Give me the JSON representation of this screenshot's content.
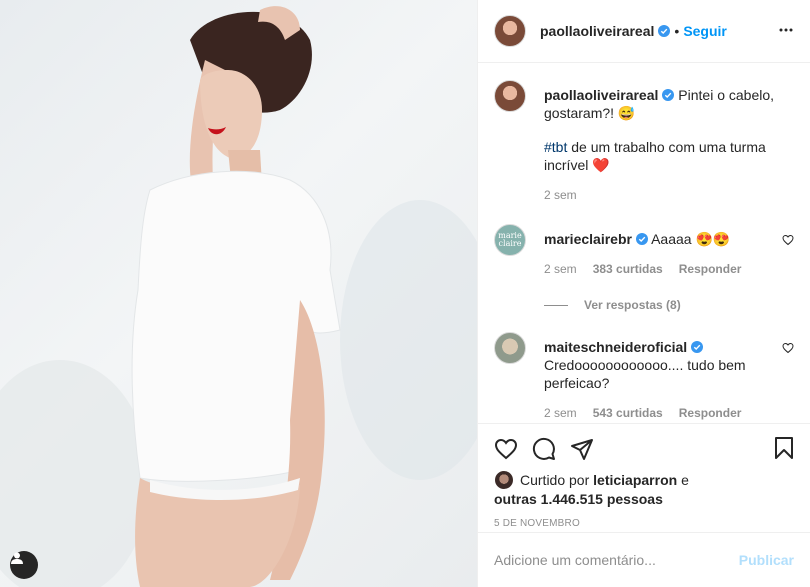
{
  "post": {
    "username": "paollaoliveirareal",
    "follow_label": "Seguir",
    "separator": "•"
  },
  "caption": {
    "username": "paollaoliveirareal",
    "text_part1": " Pintei o cabelo, gostaram?! 😅",
    "hashtag": "#tbt",
    "text_part2": " de um trabalho com uma turma incrível ❤️",
    "time": "2 sem"
  },
  "comments": [
    {
      "username": "marieclairebr",
      "text": " Aaaaa 😍😍",
      "time": "2 sem",
      "likes": "383 curtidas",
      "reply": "Responder",
      "avatar_text": "marie claire",
      "view_replies": "Ver respostas (8)"
    },
    {
      "username": "maiteschneideroficial",
      "text": "Credoooooooooooo.... tudo bem perfeicao?",
      "time": "2 sem",
      "likes": "543 curtidas",
      "reply": "Responder"
    }
  ],
  "likes": {
    "prefix": "Curtido por ",
    "user": "leticiaparron",
    "middle": " e",
    "others": "outras 1.446.515 pessoas"
  },
  "date": "5 DE NOVEMBRO",
  "add_comment": {
    "placeholder": "Adicione um comentário...",
    "publish_label": "Publicar"
  },
  "colors": {
    "accent": "#0095f6",
    "verified": "#3897f0",
    "publish_disabled": "#b2dffc",
    "muted": "#8e8e8e"
  },
  "icons": [
    "user-tag-icon",
    "verified-icon",
    "more-options-icon",
    "heart-icon",
    "comment-icon",
    "share-icon",
    "bookmark-icon"
  ]
}
